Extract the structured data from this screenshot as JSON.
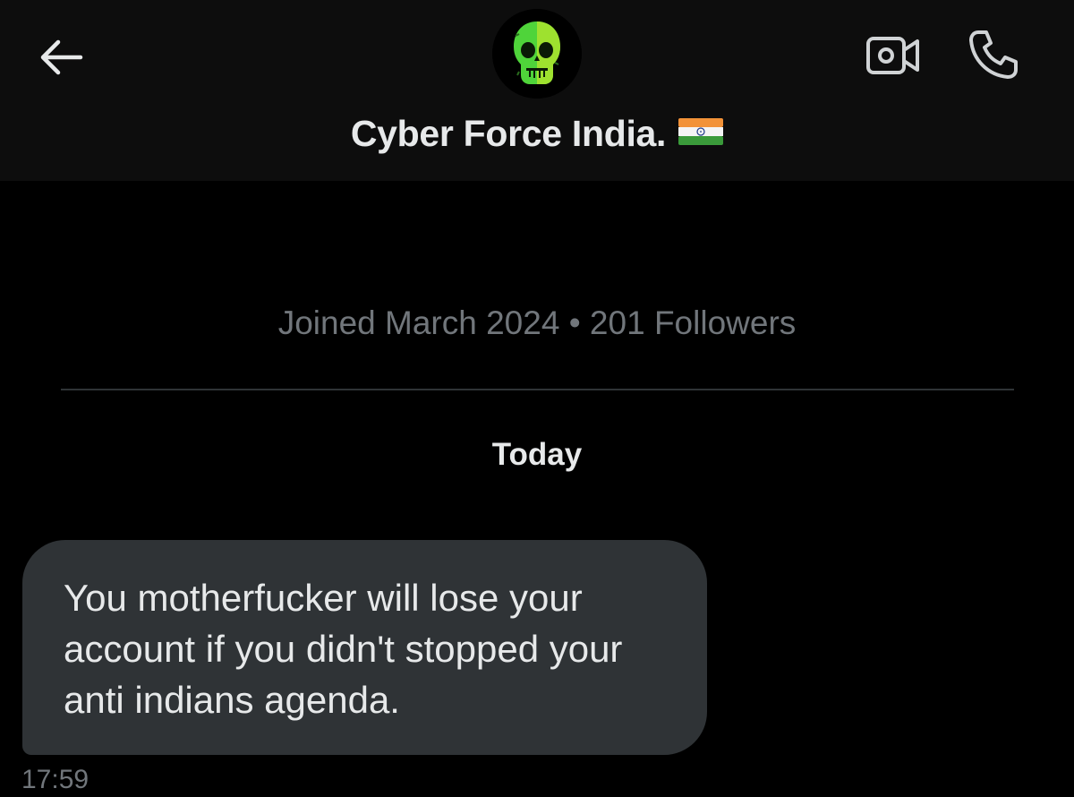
{
  "header": {
    "contact_name": "Cyber Force India.",
    "avatar_icon": "green-skull-icon",
    "back_icon": "arrow-left-icon",
    "video_icon": "video-camera-icon",
    "call_icon": "phone-icon",
    "flag": "india-flag-icon"
  },
  "profile": {
    "meta": "Joined March 2024 • 201 Followers"
  },
  "conversation": {
    "date_separator": "Today",
    "messages": [
      {
        "text": "You motherfucker will lose your account if you didn't stopped your anti indians agenda.",
        "time": "17:59"
      }
    ]
  },
  "colors": {
    "background": "#000000",
    "header_background": "#0d0d0d",
    "bubble": "#2f3336",
    "primary_text": "#e7e9ea",
    "secondary_text": "#71767b",
    "icon": "#d0d3d5"
  }
}
